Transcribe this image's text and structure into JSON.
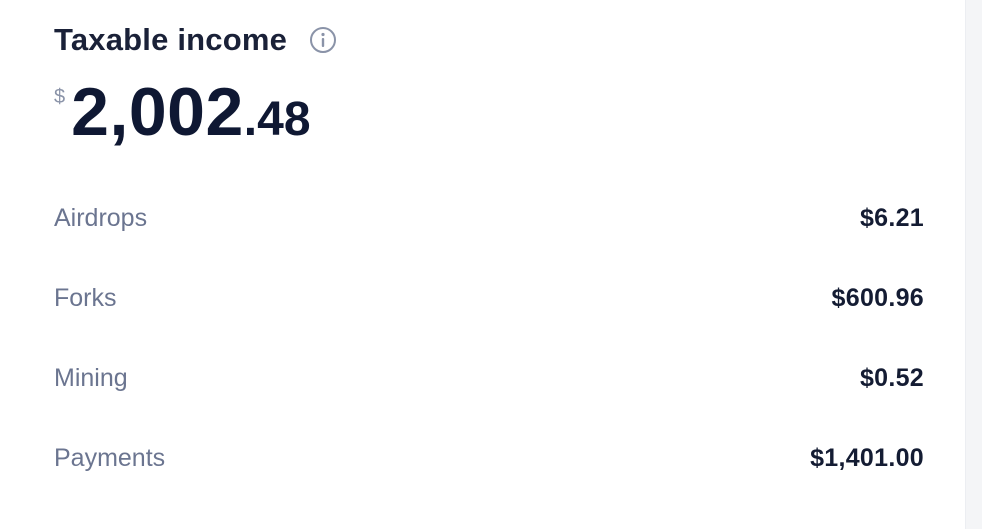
{
  "header": {
    "title": "Taxable income",
    "info_icon": "info-circle-icon"
  },
  "total": {
    "currency_symbol": "$",
    "whole": "2,002",
    "decimals": ".48"
  },
  "breakdown": [
    {
      "label": "Airdrops",
      "value": "$6.21"
    },
    {
      "label": "Forks",
      "value": "$600.96"
    },
    {
      "label": "Mining",
      "value": "$0.52"
    },
    {
      "label": "Payments",
      "value": "$1,401.00"
    }
  ],
  "colors": {
    "title": "#1a2138",
    "label": "#6b7590",
    "value": "#141c33",
    "icon": "#8a93a8"
  }
}
